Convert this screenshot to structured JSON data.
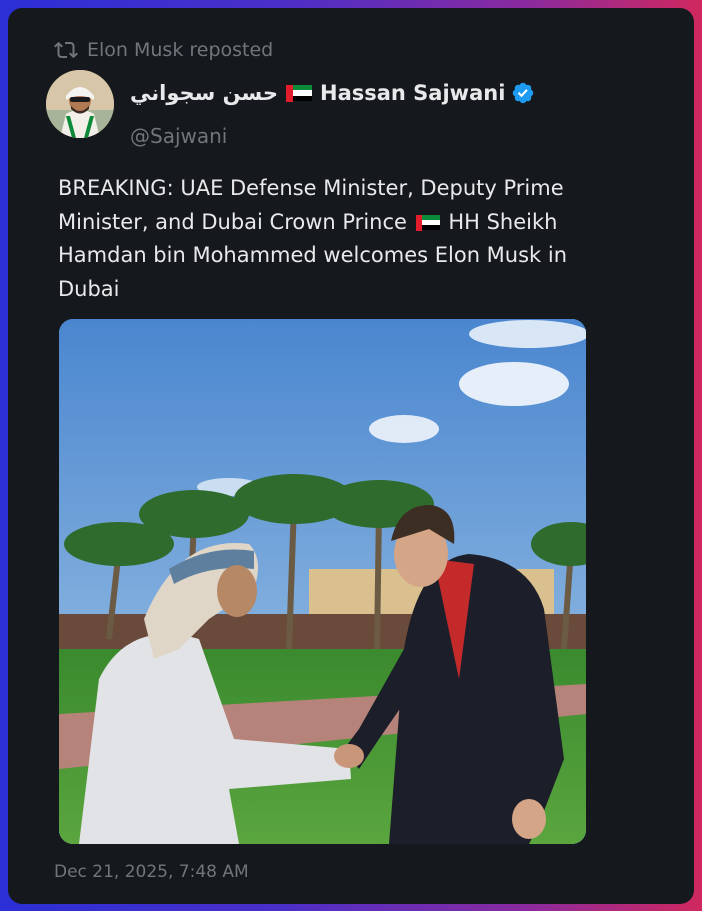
{
  "repost": {
    "icon": "repost-icon",
    "text": "Elon Musk reposted"
  },
  "author": {
    "name_arabic": "حسن سجواني",
    "name_english": "Hassan Sajwani",
    "handle": "@Sajwani",
    "verified": true,
    "flag": "uae-flag-icon"
  },
  "tweet": {
    "text_part1": "BREAKING: UAE Defense Minister, Deputy Prime Minister, and Dubai Crown Prince",
    "text_part2": "HH Sheikh Hamdan bin Mohammed welcomes Elon Musk in Dubai",
    "timestamp": "Dec 21, 2025, 7:48 AM"
  },
  "colors": {
    "card_bg": "#15181c",
    "text_primary": "#e7e9ea",
    "text_secondary": "#71767b",
    "verified_blue": "#1d9bf0"
  }
}
